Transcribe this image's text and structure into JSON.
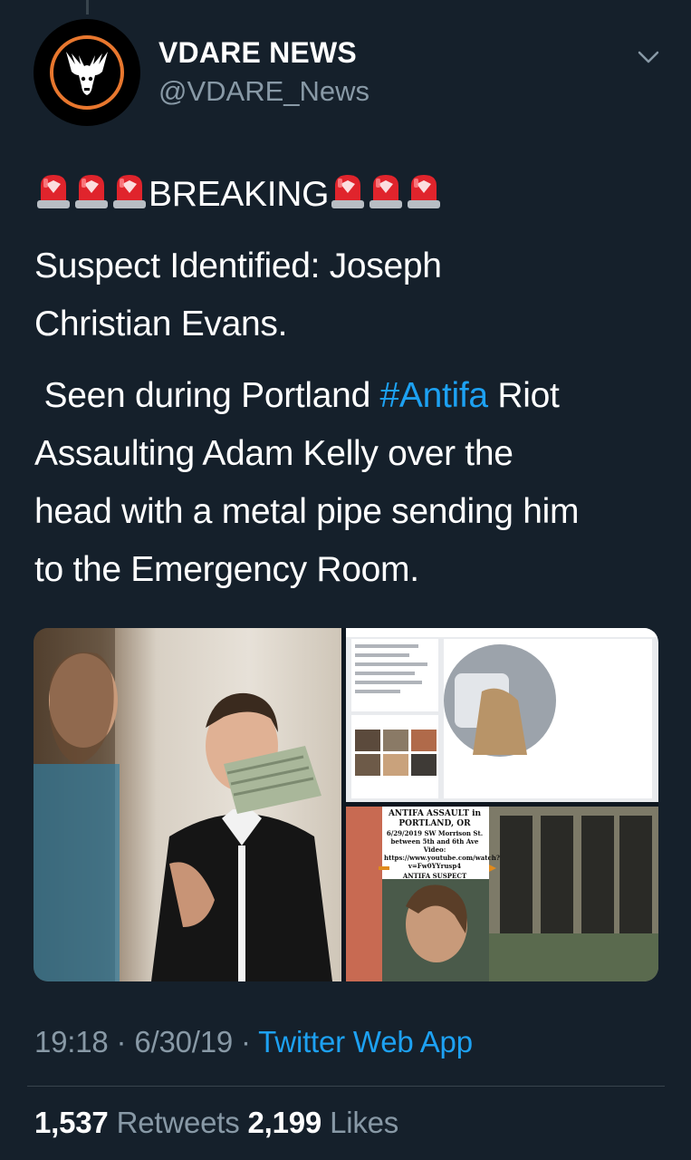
{
  "tweet": {
    "display_name": "VDARE NEWS",
    "handle": "@VDARE_News",
    "avatar_icon": "stag-skull-logo-icon",
    "menu_icon": "chevron-down-icon",
    "siren_icon": "police-car-light-emoji",
    "breaking": "BREAKING",
    "text_line1": "Suspect Identified: Joseph",
    "text_line2": "Christian Evans.",
    "text_line3_pre": " Seen during Portland ",
    "hashtag": "#Antifa",
    "text_line3_post": " Riot",
    "text_line4": "Assaulting Adam Kelly over the",
    "text_line5": "head with a metal pipe sending him",
    "text_line6": "to the Emergency Room."
  },
  "media": {
    "collage_caption_title": "ANTIFA ASSAULT in",
    "collage_caption_place": "PORTLAND, OR",
    "collage_caption_date": "6/29/2019 SW Morrison St.",
    "collage_caption_between": "between 5th and 6th Ave",
    "collage_caption_video": "Video:",
    "collage_caption_url1": "https://www.youtube.com/watch?",
    "collage_caption_url2": "v=Fw0YYrusp4",
    "collage_caption_suspect": "ANTIFA SUSPECT"
  },
  "meta": {
    "time": "19:18",
    "separator": " · ",
    "date": "6/30/19",
    "source": "Twitter Web App"
  },
  "stats": {
    "retweets_count": "1,537",
    "retweets_label": "Retweets",
    "likes_count": "2,199",
    "likes_label": "Likes"
  },
  "colors": {
    "background": "#15202b",
    "link": "#1da1f2",
    "secondary_text": "#8899a6",
    "divider": "#38444d",
    "logo_ring": "#e8772e"
  }
}
